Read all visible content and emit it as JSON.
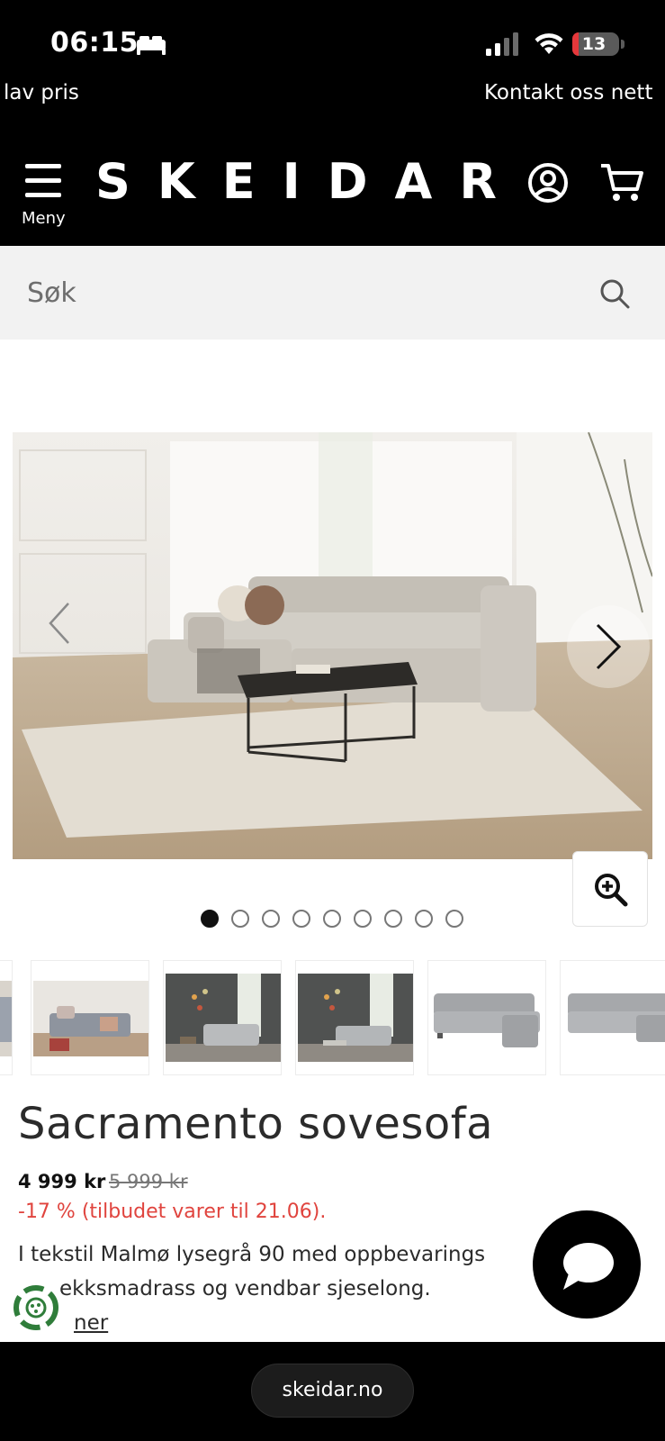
{
  "status_bar": {
    "time": "06:15",
    "battery_level": 13,
    "battery_label": "13",
    "icons": [
      "bed-icon",
      "signal-icon",
      "wifi-icon",
      "battery-icon"
    ]
  },
  "ticker": {
    "left_text": "lav pris",
    "right_text": "Kontakt oss nett"
  },
  "header": {
    "menu_label": "Meny",
    "logo_text": "SKEIDAR",
    "icons": [
      "menu-icon",
      "account-icon",
      "cart-icon"
    ]
  },
  "search": {
    "placeholder": "Søk"
  },
  "gallery": {
    "total_images": 9,
    "active_index": 0
  },
  "product": {
    "title": "Sacramento sovesofa",
    "price": "4 999 kr",
    "old_price": "5 999 kr",
    "discount_text": "-17 % (tilbudet varer til 21.06).",
    "description_line1": "I tekstil Malmø lysegrå 90 med oppbevarings",
    "description_line2": "ekksmadrass og vendbar sjeselong.",
    "more_link": "ner"
  },
  "browser": {
    "url": "skeidar.no"
  },
  "colors": {
    "header_bg": "#000000",
    "search_bg": "#f2f2f2",
    "discount": "#e0443e",
    "battery_low": "#e5383b"
  }
}
